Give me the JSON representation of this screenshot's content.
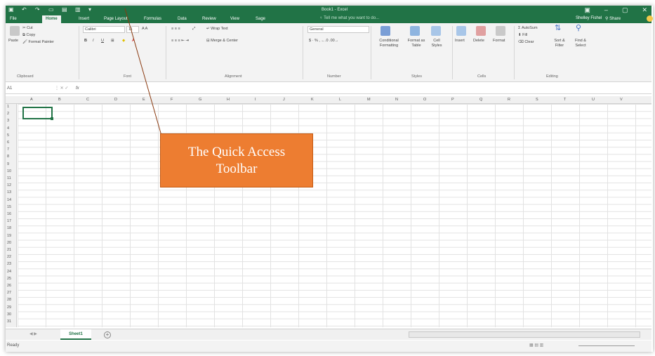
{
  "titlebar": {
    "doc_title": "Book1 - Excel",
    "qat_icons": [
      "save-icon",
      "undo-icon",
      "redo-icon",
      "new-icon",
      "open-icon",
      "print-icon",
      "customize-icon"
    ],
    "window_controls": [
      "▣",
      "–",
      "▢",
      "✕"
    ]
  },
  "tabs": {
    "file": "File",
    "home": "Home",
    "insert": "Insert",
    "page_layout": "Page Layout",
    "formulas": "Formulas",
    "data": "Data",
    "review": "Review",
    "view": "View",
    "sage": "Sage",
    "tell_me": "Tell me what you want to do...",
    "user": "Shelley Fishel",
    "share": "Share"
  },
  "ribbon": {
    "clipboard": {
      "paste": "Paste",
      "cut": "Cut",
      "copy": "Copy",
      "format_painter": "Format Painter",
      "label": "Clipboard"
    },
    "font": {
      "name": "Calibri",
      "size": "11",
      "bold": "B",
      "italic": "I",
      "underline": "U",
      "label": "Font"
    },
    "alignment": {
      "wrap_text": "Wrap Text",
      "merge_center": "Merge & Center",
      "label": "Alignment"
    },
    "number": {
      "format": "General",
      "label": "Number"
    },
    "styles": {
      "conditional": "Conditional Formatting",
      "format_table": "Format as Table",
      "cell_styles": "Cell Styles",
      "label": "Styles"
    },
    "cells": {
      "insert": "Insert",
      "delete": "Delete",
      "format": "Format",
      "label": "Cells"
    },
    "editing": {
      "autosum": "AutoSum",
      "fill": "Fill",
      "clear": "Clear",
      "sort_filter": "Sort & Filter",
      "find_select": "Find & Select",
      "label": "Editing"
    }
  },
  "formula_bar": {
    "name_box": "A1",
    "fx": "fx",
    "value": ""
  },
  "columns": [
    "A",
    "B",
    "C",
    "D",
    "E",
    "F",
    "G",
    "H",
    "I",
    "J",
    "K",
    "L",
    "M",
    "N",
    "O",
    "P",
    "Q",
    "R",
    "S",
    "T",
    "U",
    "V"
  ],
  "rows": [
    "1",
    "2",
    "3",
    "4",
    "5",
    "6",
    "7",
    "8",
    "9",
    "10",
    "11",
    "12",
    "13",
    "14",
    "15",
    "16",
    "17",
    "18",
    "19",
    "20",
    "21",
    "22",
    "23",
    "24",
    "25",
    "26",
    "27",
    "28",
    "29",
    "30",
    "31"
  ],
  "sheets": {
    "active": "Sheet1",
    "add": "+"
  },
  "status": {
    "ready": "Ready"
  },
  "callout": {
    "text": "The Quick Access Toolbar",
    "fill": "#ed7d31"
  },
  "colors": {
    "excel_green": "#217346",
    "ribbon_bg": "#f3f3f3"
  }
}
